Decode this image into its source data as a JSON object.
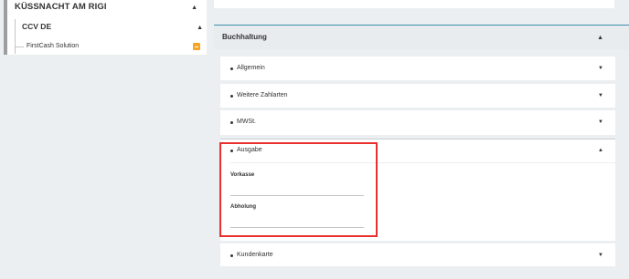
{
  "tree": {
    "root_label": "KÜSSNACHT AM RIGI",
    "child_label": "CCV DE",
    "leaf_label": "FirstCash Solution",
    "expanded_icon": "caret-up-icon",
    "badge_icon": "collapse-minus-icon",
    "badge_color": "#f5a623"
  },
  "section": {
    "title": "Buchhaltung",
    "accent_color": "#3d8fb0"
  },
  "panels": [
    {
      "label": "Allgemein",
      "state": "collapsed"
    },
    {
      "label": "Weitere Zahlarten",
      "state": "collapsed"
    },
    {
      "label": "MWSt.",
      "state": "collapsed"
    },
    {
      "label": "Ausgabe",
      "state": "expanded"
    },
    {
      "label": "Kundenkarte",
      "state": "collapsed"
    }
  ],
  "ausgabe": {
    "fields": [
      {
        "label": "Vorkasse",
        "value": ""
      },
      {
        "label": "Abholung",
        "value": ""
      }
    ],
    "highlight_color": "#e8312f"
  },
  "icons": {
    "expanded": "▲",
    "collapsed": "▼"
  }
}
